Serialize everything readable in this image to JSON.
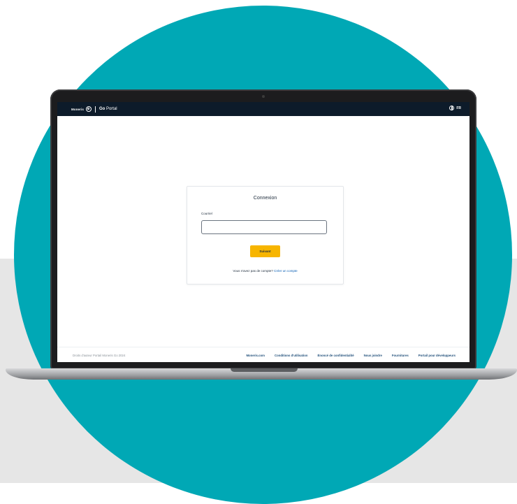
{
  "header": {
    "brand": "Moneris",
    "product_prefix": "Go",
    "product_suffix": "Portal",
    "language": "FR"
  },
  "login": {
    "title": "Connexion",
    "email_label": "Courriel",
    "email_value": "",
    "email_placeholder": "",
    "next_button": "Suivant",
    "no_account_text": "Vous n'avez pas de compte?",
    "create_account_link": "Créer un compte"
  },
  "footer": {
    "copyright": "Droits d'auteur Portail Moneris Go 2024",
    "links": [
      "Moneris.com",
      "Conditions d'utilisation",
      "Énoncé de confidentialité",
      "Nous joindre",
      "Fournitures",
      "Portail pour développeurs"
    ]
  },
  "colors": {
    "teal_circle": "#00a8b5",
    "topbar": "#0d1b2a",
    "button": "#f7b500",
    "link": "#0a5fb4",
    "background_band": "#e6e6e6"
  }
}
